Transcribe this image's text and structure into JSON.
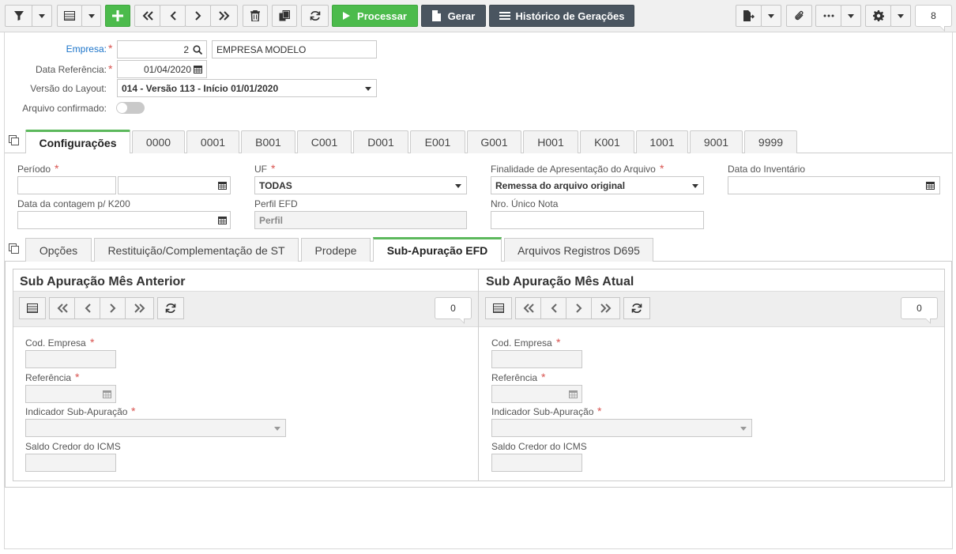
{
  "toolbar": {
    "processar_label": "Processar",
    "gerar_label": "Gerar",
    "historico_label": "Histórico de Gerações",
    "counter": "8"
  },
  "header": {
    "empresa_label": "Empresa:",
    "empresa_code": "2",
    "empresa_name": "EMPRESA MODELO",
    "data_ref_label": "Data Referência:",
    "data_ref_value": "01/04/2020",
    "versao_label": "Versão do Layout:",
    "versao_value": "014 - Versão 113 - Início 01/01/2020",
    "confirmado_label": "Arquivo confirmado:"
  },
  "tabs": [
    "Configurações",
    "0000",
    "0001",
    "B001",
    "C001",
    "D001",
    "E001",
    "G001",
    "H001",
    "K001",
    "1001",
    "9001",
    "9999"
  ],
  "config": {
    "periodo_label": "Período",
    "uf_label": "UF",
    "uf_value": "TODAS",
    "finalidade_label": "Finalidade de Apresentação do Arquivo",
    "finalidade_value": "Remessa do arquivo original",
    "data_inventario_label": "Data do Inventário",
    "data_contagem_label": "Data da contagem p/ K200",
    "perfil_label": "Perfil EFD",
    "perfil_value": "Perfil",
    "nro_nota_label": "Nro. Único Nota"
  },
  "subtabs": [
    "Opções",
    "Restituição/Complementação de ST",
    "Prodepe",
    "Sub-Apuração EFD",
    "Arquivos Registros D695"
  ],
  "panels": [
    {
      "title": "Sub Apuração Mês Anterior",
      "count": "0",
      "cod_empresa_label": "Cod. Empresa",
      "referencia_label": "Referência",
      "indicador_label": "Indicador Sub-Apuração",
      "saldo_label": "Saldo Credor do ICMS"
    },
    {
      "title": "Sub Apuração Mês Atual",
      "count": "0",
      "cod_empresa_label": "Cod. Empresa",
      "referencia_label": "Referência",
      "indicador_label": "Indicador Sub-Apuração",
      "saldo_label": "Saldo Credor do ICMS"
    }
  ],
  "colors": {
    "accent": "#5cb85c",
    "processar": "#4cbb4c",
    "gerar": "#4a5560",
    "required": "#d9534f",
    "link": "#1a73c9"
  }
}
